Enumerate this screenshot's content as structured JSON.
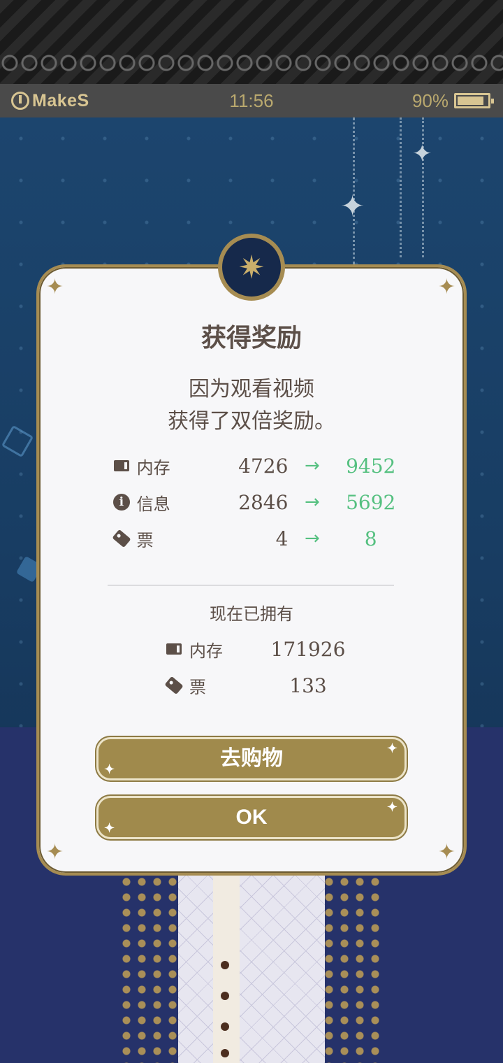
{
  "status_bar": {
    "carrier": "MakeS",
    "time": "11:56",
    "battery": "90%",
    "battery_level": 0.9
  },
  "dialog": {
    "title": "获得奖励",
    "message_line1": "因为观看视频",
    "message_line2": "获得了双倍奖励。",
    "rewards": [
      {
        "icon": "memory-icon",
        "label": "内存",
        "old": "4726",
        "arrow": "→",
        "new": "9452"
      },
      {
        "icon": "info-icon",
        "label": "信息",
        "old": "2846",
        "arrow": "→",
        "new": "5692"
      },
      {
        "icon": "ticket-icon",
        "label": "票",
        "old": "4",
        "arrow": "→",
        "new": "8"
      }
    ],
    "owned_title": "现在已拥有",
    "owned": [
      {
        "icon": "memory-icon",
        "label": "内存",
        "value": "171926"
      },
      {
        "icon": "ticket-icon",
        "label": "票",
        "value": "133"
      }
    ],
    "shop_button": "去购物",
    "ok_button": "OK"
  },
  "colors": {
    "accent_gold": "#a08a4c",
    "increase_green": "#55c080",
    "text_brown": "#5c4f48",
    "background_navy": "#1d3a5e"
  }
}
